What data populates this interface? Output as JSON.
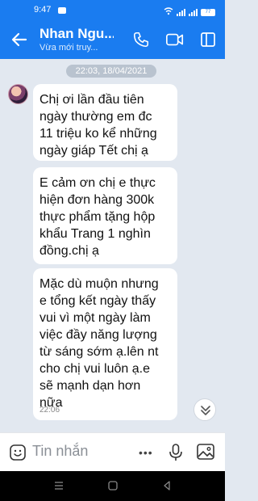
{
  "status": {
    "time": "9:47",
    "battery": "77"
  },
  "header": {
    "title": "Nhan Ngu...",
    "subtitle": "Vừa mới truy..."
  },
  "date_divider": "22:03, 18/04/2021",
  "messages": [
    {
      "text": "Chị ơi lần đầu tiên\nngày thường em đc\n11 triệu ko kể những\nngày giáp Tết chị ạ"
    },
    {
      "text": "E cảm ơn chị e thực\nhiện đơn hàng 300k\nthực phẩm tặng hộp\nkhẩu Trang 1 nghìn\nđồng.chị ạ"
    },
    {
      "text": "Mặc dù muộn nhưng\ne tổng kết ngày thấy\nvui vì một ngày làm\nviệc đầy năng lượng\ntừ sáng sớm ạ.lên nt\ncho chị vui luôn ạ.e\nsẽ mạnh dạn hơn\nnữa",
      "time": "22:06"
    }
  ],
  "composer": {
    "placeholder": "Tin nhắn",
    "more": "•••"
  },
  "colors": {
    "header": "#1a7cf0",
    "chat_bg": "#e2e8f0",
    "bubble": "#ffffff"
  }
}
